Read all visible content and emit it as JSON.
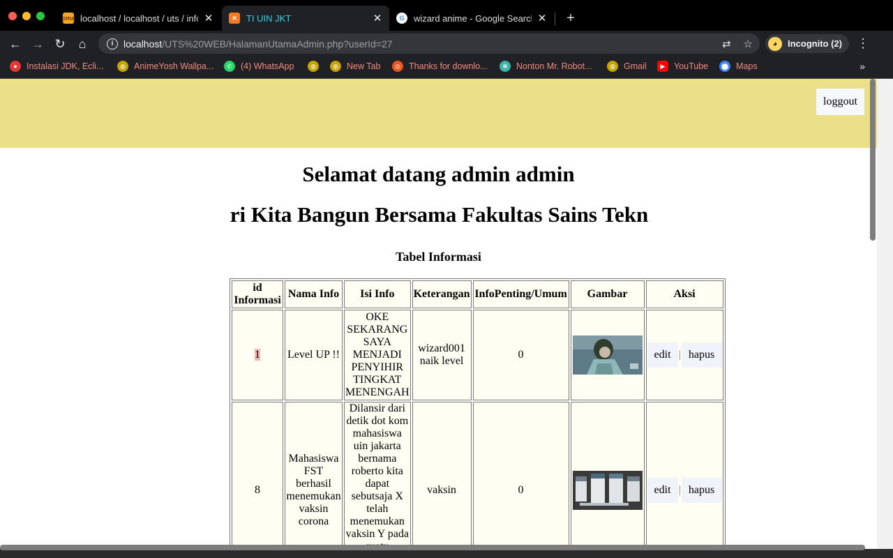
{
  "browser": {
    "tabs": [
      {
        "title": "localhost / localhost / uts / info",
        "active": false
      },
      {
        "title": "TI UIN JKT",
        "active": true
      },
      {
        "title": "wizard anime - Google Search",
        "active": false
      }
    ],
    "url_host": "localhost",
    "url_path": "/UTS%20WEB/HalamanUtamaAdmin.php?userId=27",
    "incognito_label": "Incognito (2)",
    "bookmarks": [
      {
        "label": "Instalasi JDK, Ecli...",
        "icon": "red-circle-icon",
        "color": "#e53935"
      },
      {
        "label": "AnimeYosh Wallpa...",
        "icon": "globe-icon",
        "color": "#c6a300"
      },
      {
        "label": "(4) WhatsApp",
        "icon": "whatsapp-icon",
        "color": "#25d366"
      },
      {
        "label": "",
        "icon": "globe-icon",
        "color": "#c6a300"
      },
      {
        "label": "New Tab",
        "icon": "globe-icon",
        "color": "#c6a300"
      },
      {
        "label": "Thanks for downlo...",
        "icon": "ubuntu-icon",
        "color": "#e95420"
      },
      {
        "label": "Nonton Mr. Robot...",
        "icon": "react-icon",
        "color": "#3fb3a8"
      },
      {
        "label": "Gmail",
        "icon": "globe-icon",
        "color": "#c6a300"
      },
      {
        "label": "YouTube",
        "icon": "youtube-icon",
        "color": "#ff0000"
      },
      {
        "label": "Maps",
        "icon": "maps-pin-icon",
        "color": "#4285f4"
      }
    ]
  },
  "page": {
    "logout_label": "loggout",
    "welcome": "Selamat datang admin admin",
    "marquee": "Mari Kita Bangun Bersama Fakultas Sains Teknologi",
    "table_caption": "Tabel Informasi",
    "headers": [
      "id Informasi",
      "Nama Info",
      "Isi Info",
      "Keterangan",
      "InfoPenting/Umum",
      "Gambar",
      "Aksi"
    ],
    "rows": [
      {
        "id": "1",
        "nama": "Level UP !!",
        "isi": "OKE SEKARANG SAYA MENJADI PENYIHIR TINGKAT MENENGAH",
        "keterangan": "wizard001 naik level",
        "penting": "0",
        "gambar": "anime-wizard-image"
      },
      {
        "id": "8",
        "nama": "Mahasiswa FST berhasil menemukan vaksin corona",
        "isi": "Dilansir dari detik dot kom mahasiswa uin jakarta bernama roberto kita dapat sebutsaja X telah menemukan vaksin Y pada suatu",
        "keterangan": "vaksin",
        "penting": "0",
        "gambar": "vaccine-vials-image"
      }
    ],
    "action_edit": "edit",
    "action_delete": "hapus"
  }
}
